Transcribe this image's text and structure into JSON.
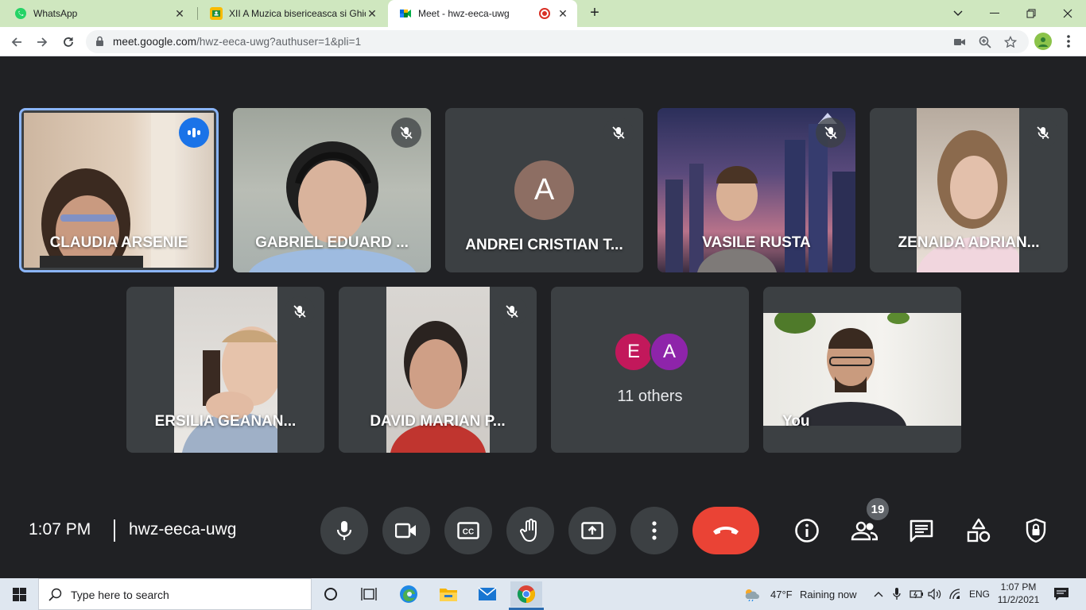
{
  "browser": {
    "tabs": [
      {
        "title": "WhatsApp",
        "favicon": "whatsapp-icon",
        "active": false
      },
      {
        "title": "XII A Muzica bisericeasca si Ghid",
        "favicon": "classroom-icon",
        "active": false
      },
      {
        "title": "Meet - hwz-eeca-uwg",
        "favicon": "meet-icon",
        "active": true
      }
    ],
    "url_host": "meet.google.com",
    "url_path": "/hwz-eeca-uwg?authuser=1&pli=1"
  },
  "meeting": {
    "participants": [
      {
        "name": "CLAUDIA ARSENIE",
        "state": "speaking"
      },
      {
        "name": "GABRIEL EDUARD ...",
        "state": "muted"
      },
      {
        "name": "ANDREI CRISTIAN T...",
        "state": "muted",
        "avatar_letter": "A"
      },
      {
        "name": "VASILE RUSTA",
        "state": "muted"
      },
      {
        "name": "ZENAIDA ADRIAN...",
        "state": "muted"
      },
      {
        "name": "ERSILIA GEANAN...",
        "state": "muted"
      },
      {
        "name": "DAVID MARIAN P...",
        "state": "muted"
      },
      {
        "name": "You",
        "state": "self"
      }
    ],
    "others": {
      "avatars": [
        "E",
        "A"
      ],
      "label": "11 others"
    },
    "time": "1:07 PM",
    "code": "hwz-eeca-uwg",
    "people_count": "19"
  },
  "taskbar": {
    "search_placeholder": "Type here to search",
    "weather_temp": "47°F",
    "weather_desc": "Raining now",
    "language": "ENG",
    "clock_time": "1:07 PM",
    "clock_date": "11/2/2021"
  },
  "colors": {
    "meet_bg": "#202124",
    "tile_bg": "#3c4043",
    "end_call_red": "#ea4335",
    "speaking_blue": "#1a73e8",
    "tab_strip_green": "#cfe7bf"
  }
}
